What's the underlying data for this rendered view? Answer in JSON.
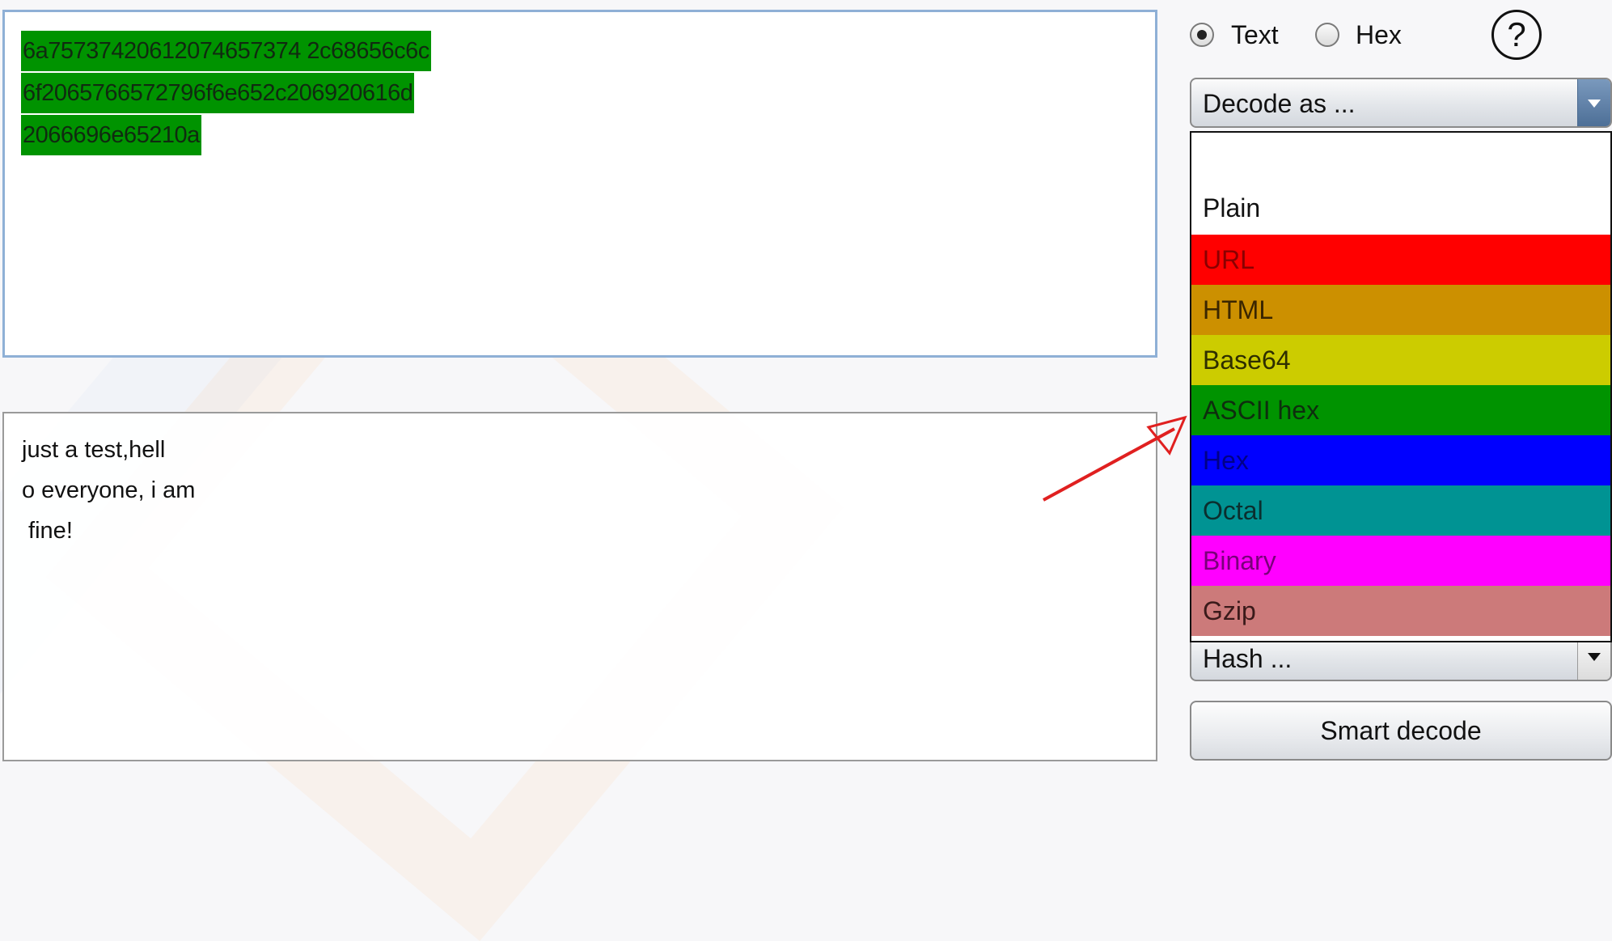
{
  "input_panel": {
    "lines": [
      "6a75737420612074657374 2c68656c6c",
      "6f2065766572796f6e652c206920616d",
      "2066696e65210a"
    ]
  },
  "output_panel": {
    "lines": [
      "just a test,hell",
      "o everyone, i am",
      " fine!"
    ]
  },
  "mode": {
    "text_label": "Text",
    "hex_label": "Hex",
    "selected": "Text"
  },
  "help": {
    "glyph": "?"
  },
  "decode": {
    "placeholder": "Decode as ...",
    "options": [
      {
        "label": "",
        "bg": "#ffffff",
        "fg": "#111111"
      },
      {
        "label": "Plain",
        "bg": "#ffffff",
        "fg": "#111111"
      },
      {
        "label": "URL",
        "bg": "#ff0000",
        "fg": "#8a0000"
      },
      {
        "label": "HTML",
        "bg": "#cc9000",
        "fg": "#3a2600"
      },
      {
        "label": "Base64",
        "bg": "#cccc00",
        "fg": "#2e2e00"
      },
      {
        "label": "ASCII hex",
        "bg": "#009300",
        "fg": "#0e2e0e"
      },
      {
        "label": "Hex",
        "bg": "#0000ff",
        "fg": "#000088"
      },
      {
        "label": "Octal",
        "bg": "#009393",
        "fg": "#0b2e2e"
      },
      {
        "label": "Binary",
        "bg": "#ff00ff",
        "fg": "#7a007a"
      },
      {
        "label": "Gzip",
        "bg": "#cc7a7a",
        "fg": "#3a1a1a"
      }
    ]
  },
  "hash": {
    "placeholder": "Hash ..."
  },
  "smart_decode": {
    "label": "Smart decode"
  },
  "colors": {
    "input_border": "#8fb0d6",
    "highlight": "#009300",
    "annotation_arrow": "#e02020"
  }
}
